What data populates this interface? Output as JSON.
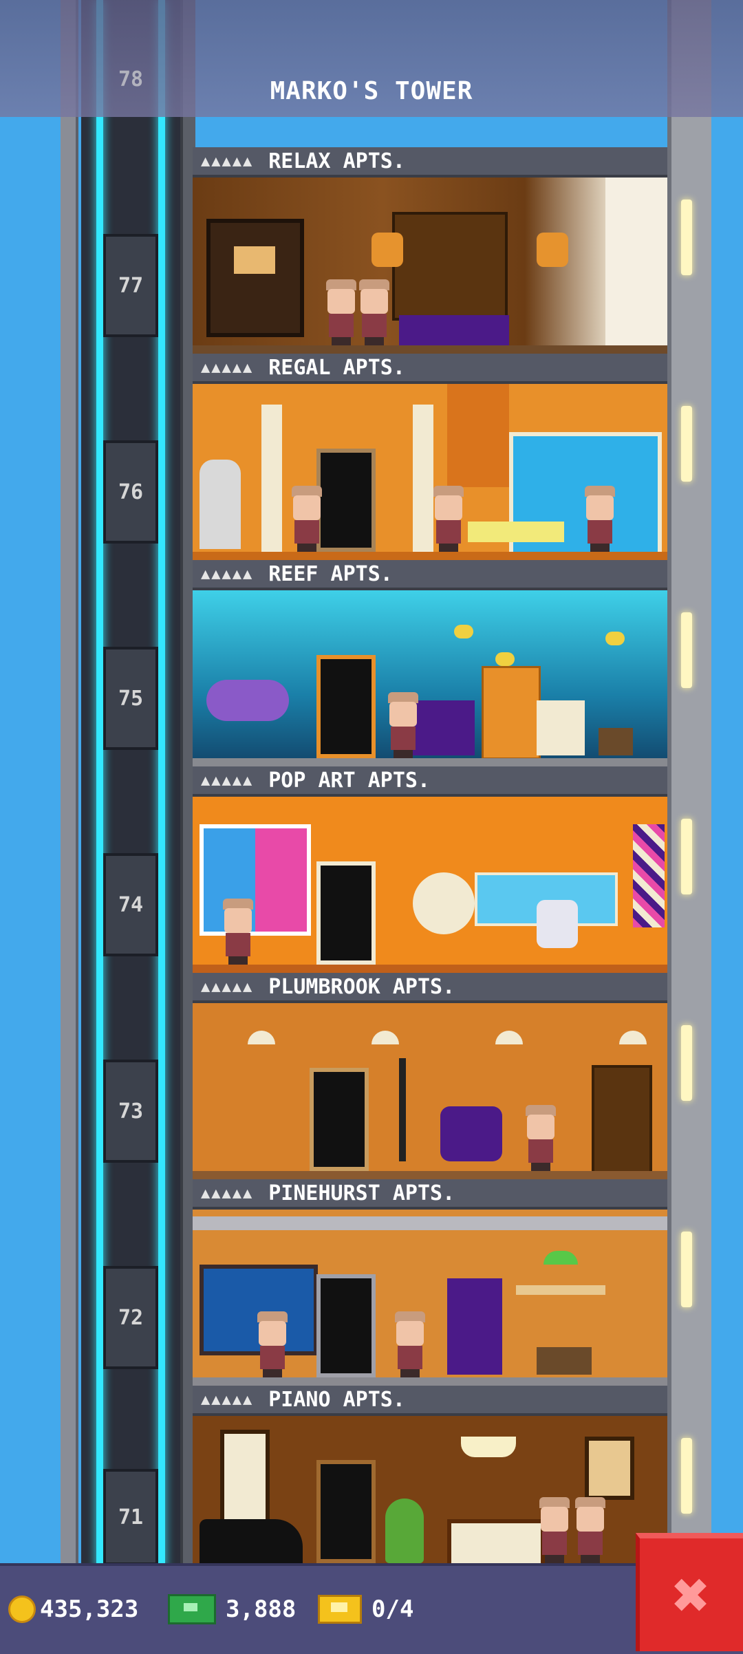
{
  "header": {
    "title": "MARKO'S TOWER",
    "top_floor": "78"
  },
  "floors": [
    {
      "number": "77",
      "name": "RELAX APTS.",
      "stars": "▲▲▲▲▲",
      "wall": "#7a4a1e"
    },
    {
      "number": "76",
      "name": "REGAL APTS.",
      "stars": "▲▲▲▲▲",
      "wall": "#e8902a"
    },
    {
      "number": "75",
      "name": "REEF APTS.",
      "stars": "▲▲▲▲▲",
      "wall": "#1aa6c8"
    },
    {
      "number": "74",
      "name": "POP ART APTS.",
      "stars": "▲▲▲▲▲",
      "wall": "#f08a1c"
    },
    {
      "number": "73",
      "name": "PLUMBROOK APTS.",
      "stars": "▲▲▲▲▲",
      "wall": "#d6802a"
    },
    {
      "number": "72",
      "name": "PINEHURST APTS.",
      "stars": "▲▲▲▲▲",
      "wall": "#d98a34"
    },
    {
      "number": "71",
      "name": "PIANO APTS.",
      "stars": "▲▲▲▲▲",
      "wall": "#7a4214"
    }
  ],
  "currencies": {
    "coins": "435,323",
    "bux": "3,888",
    "tickets": "0/4"
  },
  "close_button": {
    "label": "✖"
  },
  "colors": {
    "sky": "#43a9ec",
    "elevator_light": "#33e8ff",
    "close": "#e02a2a"
  }
}
